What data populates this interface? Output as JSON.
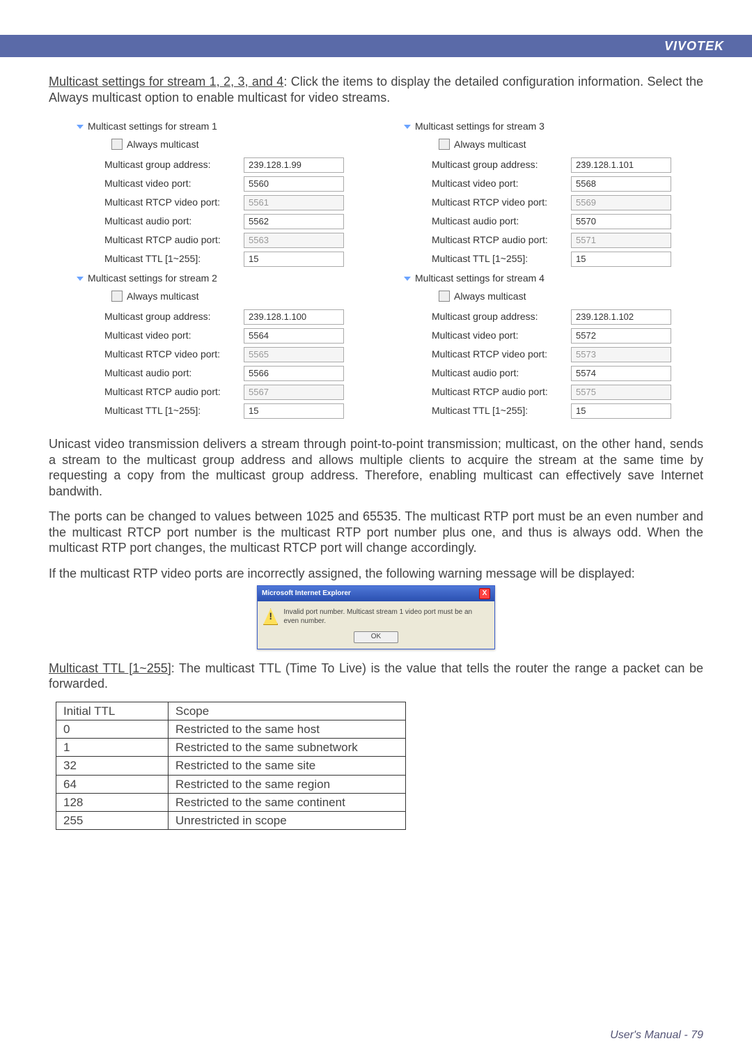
{
  "brand": "VIVOTEK",
  "paragraphs": {
    "intro_u": "Multicast settings for stream 1, 2, 3, and 4",
    "intro_rest": ": Click the items to display the detailed configuration information. Select the Always multicast option to enable multicast for video streams.",
    "unicast": "Unicast video transmission delivers a stream through point-to-point transmission; multicast, on the other hand, sends a stream to the multicast group address and allows multiple clients to acquire the stream at the same time by requesting a copy from the multicast group address. Therefore, enabling multicast can effectively save Internet bandwith.",
    "ports": "The ports can be changed to values between 1025 and 65535. The multicast RTP port must be an even number and the multicast RTCP port number is the multicast RTP port number plus one, and thus is always odd. When the multicast RTP port changes, the multicast RTCP port will change accordingly.",
    "warn": "If the multicast RTP video ports are incorrectly assigned, the following warning message will be displayed:",
    "ttl_u": "Multicast TTL [1~255]",
    "ttl_rest": ": The multicast TTL (Time To Live) is the value that tells the router the range a packet can be forwarded."
  },
  "labels": {
    "always": "Always multicast",
    "group": "Multicast group address:",
    "vport": "Multicast video port:",
    "rtcpv": "Multicast RTCP video port:",
    "aport": "Multicast audio port:",
    "rtcpa": "Multicast RTCP audio port:",
    "ttl": "Multicast TTL [1~255]:"
  },
  "streams": {
    "s1": {
      "title": "Multicast settings for stream 1",
      "group": "239.128.1.99",
      "vport": "5560",
      "rtcpv": "5561",
      "aport": "5562",
      "rtcpa": "5563",
      "ttl": "15"
    },
    "s2": {
      "title": "Multicast settings for stream 2",
      "group": "239.128.1.100",
      "vport": "5564",
      "rtcpv": "5565",
      "aport": "5566",
      "rtcpa": "5567",
      "ttl": "15"
    },
    "s3": {
      "title": "Multicast settings for stream 3",
      "group": "239.128.1.101",
      "vport": "5568",
      "rtcpv": "5569",
      "aport": "5570",
      "rtcpa": "5571",
      "ttl": "15"
    },
    "s4": {
      "title": "Multicast settings for stream 4",
      "group": "239.128.1.102",
      "vport": "5572",
      "rtcpv": "5573",
      "aport": "5574",
      "rtcpa": "5575",
      "ttl": "15"
    }
  },
  "dialog": {
    "title": "Microsoft Internet Explorer",
    "msg": "Invalid port number. Multicast stream 1 video port must be an even number.",
    "ok": "OK",
    "close": "X"
  },
  "ttl_table": {
    "h1": "Initial TTL",
    "h2": "Scope",
    "rows": [
      {
        "ttl": "0",
        "scope": "Restricted to the same host"
      },
      {
        "ttl": "1",
        "scope": "Restricted to the same subnetwork"
      },
      {
        "ttl": "32",
        "scope": "Restricted to the same site"
      },
      {
        "ttl": "64",
        "scope": "Restricted to the same region"
      },
      {
        "ttl": "128",
        "scope": "Restricted to the same continent"
      },
      {
        "ttl": "255",
        "scope": "Unrestricted in scope"
      }
    ]
  },
  "footer": "User's Manual - 79"
}
